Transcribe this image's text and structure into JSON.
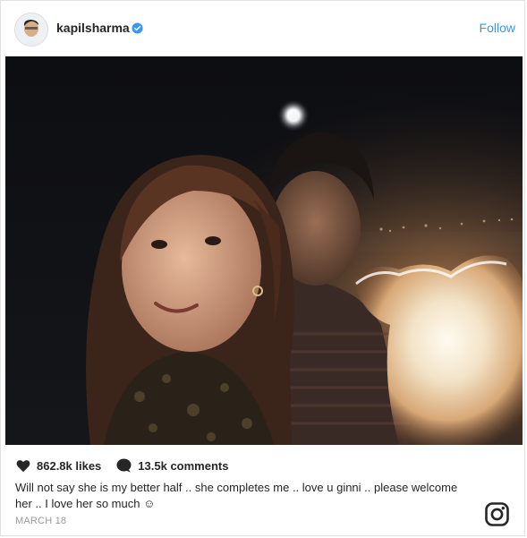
{
  "post": {
    "username": "kapilsharma",
    "follow_label": "Follow",
    "likes": "862.8k likes",
    "comments": "13.5k comments",
    "caption": "Will not say she is my better half .. she completes me .. love u ginni .. please welcome her .. I love her so much ☺",
    "date": "MARCH 18"
  },
  "icons": {
    "verified": "verified-badge-icon",
    "like": "heart-icon",
    "comment": "comment-bubble-icon",
    "brand": "instagram-logo-icon"
  },
  "colors": {
    "accent": "#3897f0",
    "text": "#262626",
    "muted": "#999999",
    "border": "#e1e1e1"
  }
}
